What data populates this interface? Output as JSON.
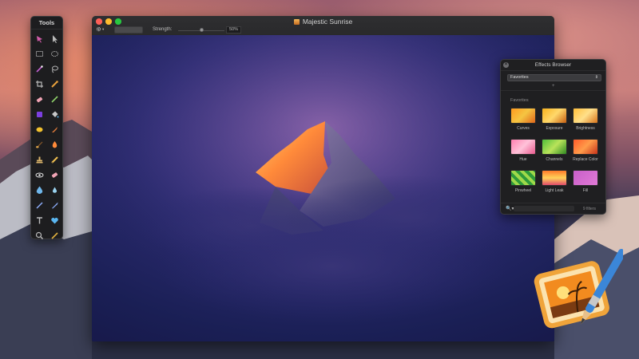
{
  "tools": {
    "title": "Tools",
    "items": [
      {
        "name": "lasso-pointer-icon",
        "color": "#d35caa"
      },
      {
        "name": "arrow-pointer-icon",
        "color": "#b8b8b8"
      },
      {
        "name": "rect-select-icon",
        "color": "#b8b8b8"
      },
      {
        "name": "ellipse-select-icon",
        "color": "#b8b8b8"
      },
      {
        "name": "magic-wand-icon",
        "color": "#c25fd0"
      },
      {
        "name": "lasso-icon",
        "color": "#b8b8b8"
      },
      {
        "name": "crop-icon",
        "color": "#b8b8b8"
      },
      {
        "name": "eyedropper-icon",
        "color": "#e8a03c"
      },
      {
        "name": "eraser-icon",
        "color": "#f0a3b4"
      },
      {
        "name": "pen-icon",
        "color": "#8fd16a"
      },
      {
        "name": "color-square-icon",
        "color": "#7c3fe0"
      },
      {
        "name": "paint-bucket-icon",
        "color": "#c8c8c8"
      },
      {
        "name": "sponge-icon",
        "color": "#f2c12e"
      },
      {
        "name": "smudge-icon",
        "color": "#e07b3a"
      },
      {
        "name": "brush-icon",
        "color": "#e0a64a"
      },
      {
        "name": "burn-icon",
        "color": "#ff8a3a"
      },
      {
        "name": "stamp-icon",
        "color": "#d9b36a"
      },
      {
        "name": "pencil-icon",
        "color": "#f0c050"
      },
      {
        "name": "eye-icon",
        "color": "#e8e8e8"
      },
      {
        "name": "rubber-icon",
        "color": "#f0a3b4"
      },
      {
        "name": "drop-icon",
        "color": "#6fb6ea"
      },
      {
        "name": "blur-icon",
        "color": "#9ad3f0"
      },
      {
        "name": "line-icon",
        "color": "#8fb0ff"
      },
      {
        "name": "feather-pen-icon",
        "color": "#8fb0ff"
      },
      {
        "name": "text-icon",
        "color": "#bdbdbd"
      },
      {
        "name": "heart-shape-icon",
        "color": "#5ab6f0"
      },
      {
        "name": "zoom-icon",
        "color": "#bdbdbd"
      },
      {
        "name": "ruler-icon",
        "color": "#e0b040"
      }
    ]
  },
  "window": {
    "title": "Majestic Sunrise",
    "strength_label": "Strength:",
    "strength_value": "50%",
    "strength_fraction": 0.5
  },
  "effects_browser": {
    "title": "Effects Browser",
    "selected_category": "Favorites",
    "section_title": "Favorites",
    "effects": [
      {
        "label": "Curves",
        "gradient": "linear-gradient(135deg,#ff9a1f,#f5c542,#e0661a)"
      },
      {
        "label": "Exposure",
        "gradient": "linear-gradient(135deg,#f7b21d,#ffd86b,#c75f12)"
      },
      {
        "label": "Brightness",
        "gradient": "linear-gradient(135deg,#ffbe3a,#ffe08a,#d8741c)"
      },
      {
        "label": "Hue",
        "gradient": "linear-gradient(135deg,#ff7fb0,#ffc2d9,#e85a8e)"
      },
      {
        "label": "Channels",
        "gradient": "linear-gradient(135deg,#4fbf3a,#b9e35a,#2f8a22)"
      },
      {
        "label": "Replace Color",
        "gradient": "linear-gradient(135deg,#ff5a2a,#ff9c4a,#c8331a)"
      },
      {
        "label": "Pinwheel",
        "gradient": "repeating-linear-gradient(45deg,#2e9a3a 0 4px,#9fd94a 4px 8px)"
      },
      {
        "label": "Light Leak",
        "gradient": "linear-gradient(180deg,#ff7a2a,#ffd25a,#e04a6a)"
      },
      {
        "label": "Fill",
        "gradient": "linear-gradient(135deg,#c95fc9,#e07ad6)"
      }
    ],
    "add_symbol": "+",
    "search_symbol": "🔍▾",
    "filter_count": "9 filters"
  }
}
